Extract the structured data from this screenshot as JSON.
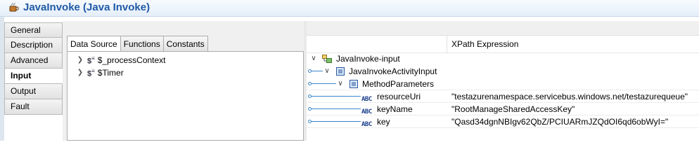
{
  "header": {
    "title": "JavaInvoke (Java Invoke)",
    "icon": "java-invoke-icon"
  },
  "sidenav": {
    "items": [
      {
        "label": "General",
        "active": false
      },
      {
        "label": "Description",
        "active": false
      },
      {
        "label": "Advanced",
        "active": false
      },
      {
        "label": "Input",
        "active": true
      },
      {
        "label": "Output",
        "active": false
      },
      {
        "label": "Fault",
        "active": false
      }
    ]
  },
  "data_source": {
    "tabs": [
      {
        "label": "Data Source",
        "active": true
      },
      {
        "label": "Functions",
        "active": false
      },
      {
        "label": "Constants",
        "active": false
      }
    ],
    "tree": [
      {
        "label": "$_processContext"
      },
      {
        "label": "$Timer"
      }
    ]
  },
  "mapper": {
    "column_header": "XPath Expression",
    "rows": [
      {
        "label": "JavaInvoke-input",
        "xpath": ""
      },
      {
        "label": "JavaInvokeActivityInput",
        "xpath": ""
      },
      {
        "label": "MethodParameters",
        "xpath": ""
      },
      {
        "label": "resourceUri",
        "xpath": "\"testazurenamespace.servicebus.windows.net/testazurequeue\""
      },
      {
        "label": "keyName",
        "xpath": "\"RootManageSharedAccessKey\""
      },
      {
        "label": "key",
        "xpath": "\"Qasd34dgnNBIgv62QbZ/PCIUARmJZQdOI6qd6obWyI=\""
      }
    ],
    "type_badge": "ABC"
  },
  "colors": {
    "title": "#1f5aa6",
    "wire": "#3a86c8",
    "badge": "#1c3f8e"
  }
}
